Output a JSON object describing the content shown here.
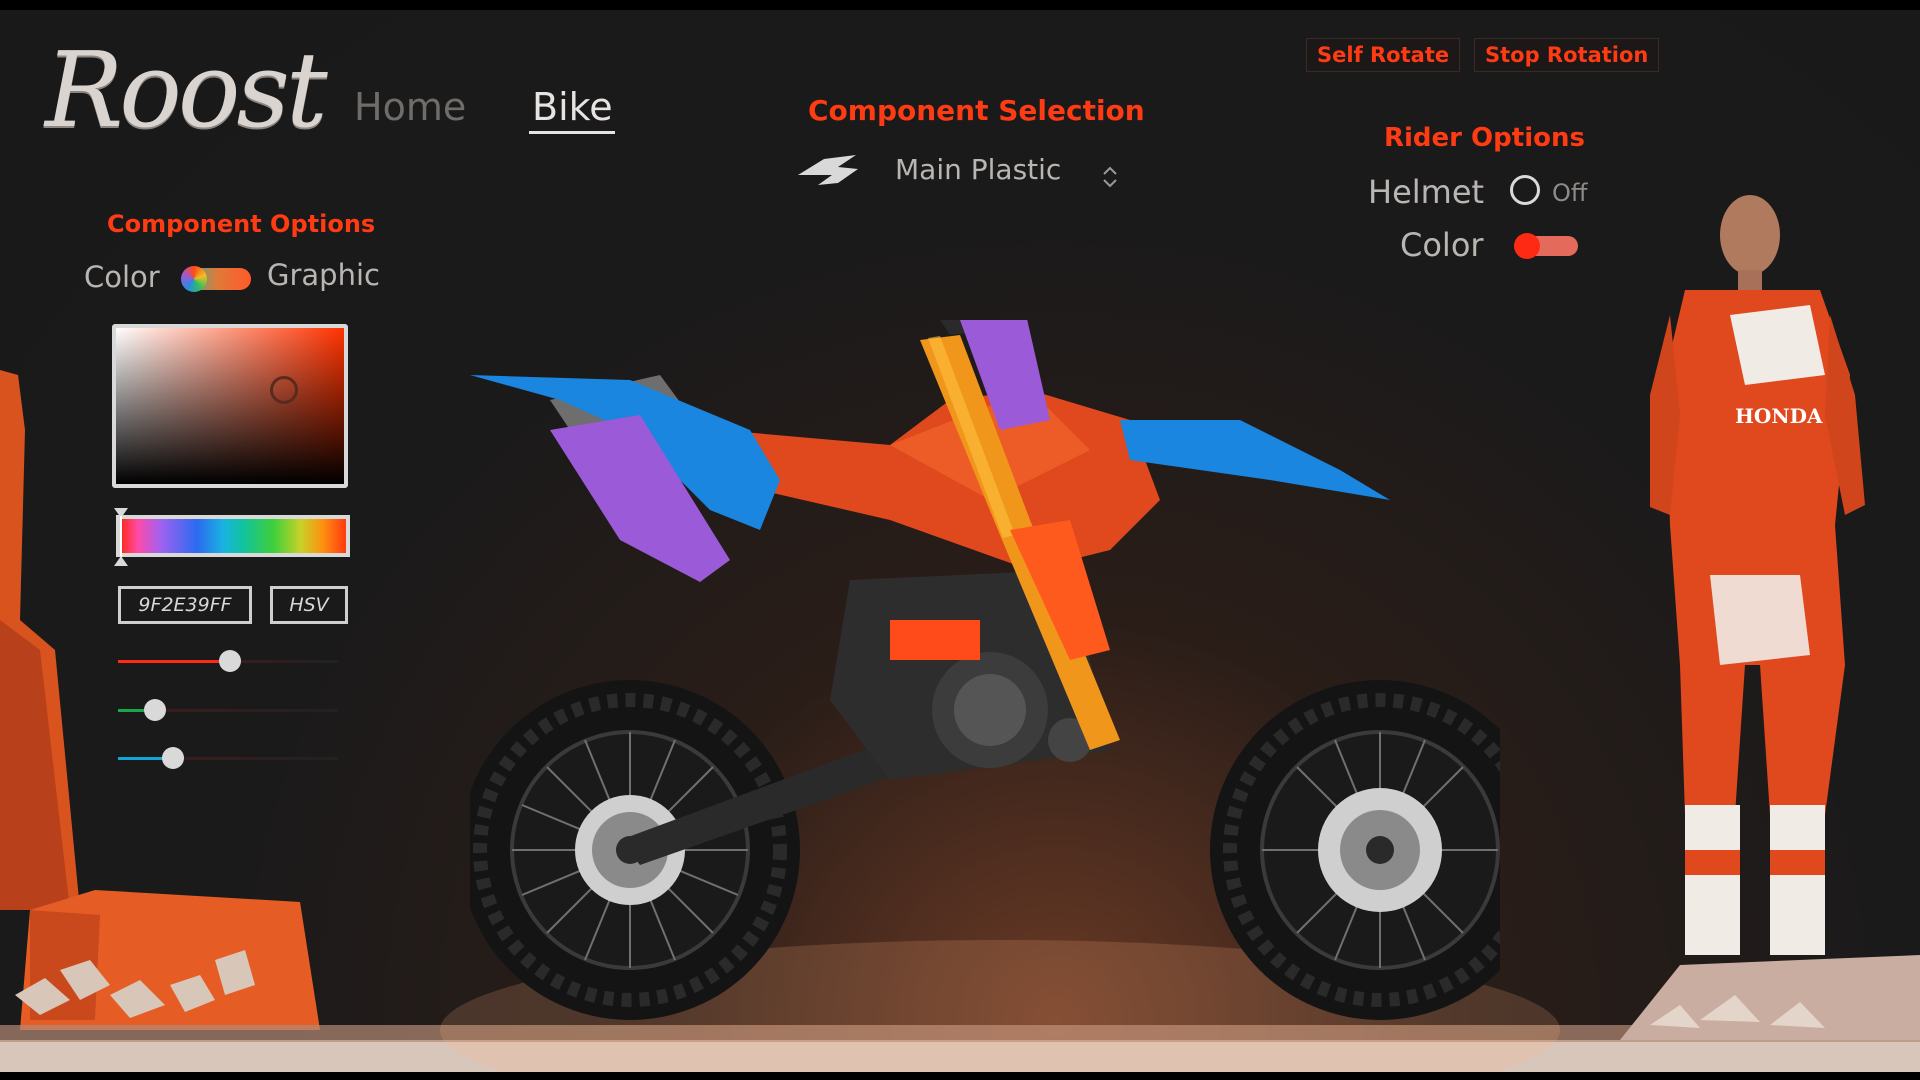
{
  "app": {
    "logo_text": "Roost"
  },
  "nav": {
    "home_label": "Home",
    "bike_label": "Bike",
    "active": "Bike"
  },
  "controls": {
    "self_rotate_label": "Self Rotate",
    "stop_rotation_label": "Stop Rotation"
  },
  "component_selection": {
    "title": "Component Selection",
    "selected": "Main Plastic",
    "icons": {
      "back": "arrow-left-icon",
      "dropdown": "updown-chevron-icon"
    }
  },
  "component_options": {
    "title": "Component Options",
    "left_mode_label": "Color",
    "right_mode_label": "Graphic",
    "hex_value": "9F2E39FF",
    "mode_button_label": "HSV",
    "sliders": [
      {
        "name": "red",
        "color": "#ff2a14",
        "value": 0.51
      },
      {
        "name": "green",
        "color": "#18a84a",
        "value": 0.17
      },
      {
        "name": "blue",
        "color": "#10a6d8",
        "value": 0.25
      }
    ]
  },
  "rider_options": {
    "title": "Rider Options",
    "helmet_label": "Helmet",
    "helmet_state": "Off",
    "color_label": "Color"
  },
  "decals": {
    "rider_logo_text": "HONDA"
  },
  "colors": {
    "accent": "#ff3b14",
    "bike_orange": "#e0481d",
    "bike_blue": "#1a86e0",
    "bike_purple": "#9b5ad8",
    "fork_gold": "#f0961a"
  }
}
